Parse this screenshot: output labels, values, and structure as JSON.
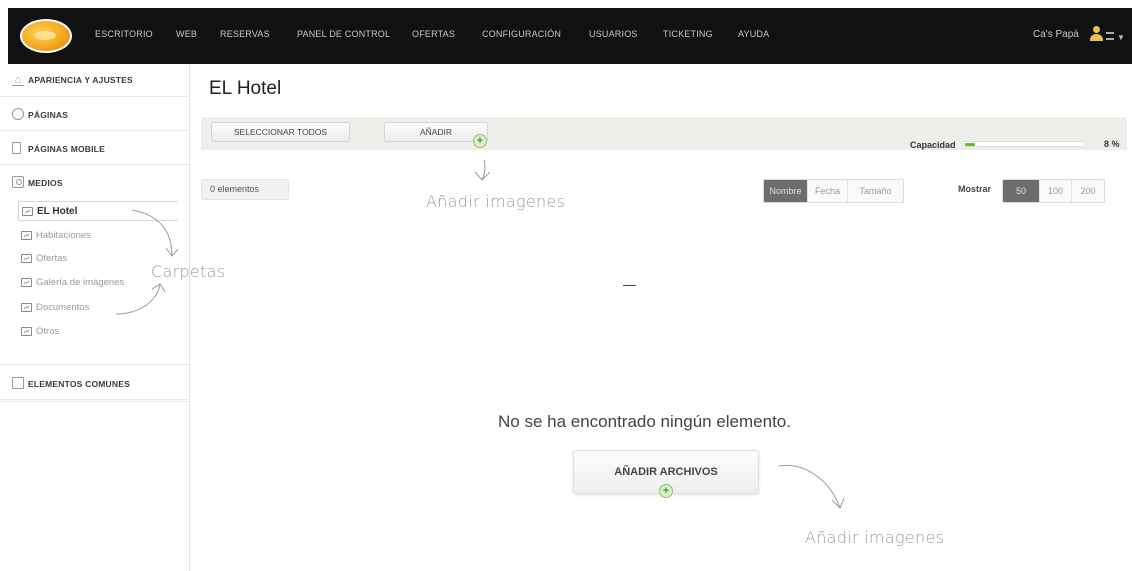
{
  "nav": {
    "items": [
      "ESCRITORIO",
      "WEB",
      "RESERVAS",
      "PANEL DE CONTROL",
      "OFERTAS",
      "CONFIGURACIÓN",
      "USUARIOS",
      "TICKETING",
      "AYUDA"
    ],
    "user_name": "Ca's Papá"
  },
  "sidebar": {
    "sections": [
      "APARIENCIA Y AJUSTES",
      "PÁGINAS",
      "PÁGINAS MOBILE",
      "MEDIOS",
      "ELEMENTOS COMUNES"
    ],
    "folders": [
      "EL Hotel",
      "Habitaciones",
      "Ofertas",
      "Galería de imágenes",
      "Documentos",
      "Otros"
    ]
  },
  "main": {
    "title": "EL Hotel",
    "select_all": "SELECCIONAR TODOS",
    "add": "AÑADIR",
    "capacity_label": "Capacidad",
    "capacity_percent": 8,
    "capacity_text": "8 %",
    "count": "0 elementos",
    "sort": [
      "Nombre",
      "Fecha",
      "Tamaño"
    ],
    "sort_active": "Nombre",
    "show_label": "Mostrar",
    "show": [
      "50",
      "100",
      "200"
    ],
    "show_active": "50",
    "empty_message": "No se ha encontrado ningún elemento.",
    "add_files": "AÑADIR ARCHIVOS"
  },
  "annotations": {
    "add_images_top": "Añadir imagenes",
    "folders": "Carpetas",
    "add_images_bottom": "Añadir imagenes"
  },
  "colors": {
    "topbar": "#111111",
    "accent": "#5ac02c",
    "active_segment": "#6d6d6d"
  }
}
